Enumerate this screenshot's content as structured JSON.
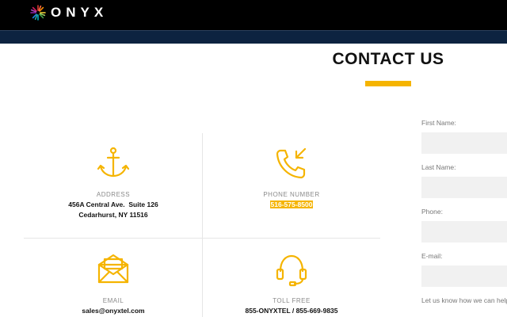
{
  "brand": {
    "name": "ONYX"
  },
  "colors": {
    "accent": "#f5b400",
    "nav": "#0d2340",
    "topbar": "#000000"
  },
  "page": {
    "title": "CONTACT US"
  },
  "contact_cards": {
    "address": {
      "icon": "anchor-icon",
      "label": "ADDRESS",
      "line1": "456A Central Ave.  Suite 126",
      "line2": "Cedarhurst, NY 11516"
    },
    "phone": {
      "icon": "phone-incoming-icon",
      "label": "PHONE NUMBER",
      "value": "516-575-8500"
    },
    "email": {
      "icon": "envelope-icon",
      "label": "EMAIL",
      "value": "sales@onyxtel.com"
    },
    "tollfree": {
      "icon": "headset-icon",
      "label": "TOLL FREE",
      "value": "855-ONYXTEL / 855-669-9835"
    }
  },
  "form": {
    "first_name_label": "First Name:",
    "last_name_label": "Last Name:",
    "phone_label": "Phone:",
    "email_label": "E-mail:",
    "message_label": "Let us know how we can help"
  }
}
